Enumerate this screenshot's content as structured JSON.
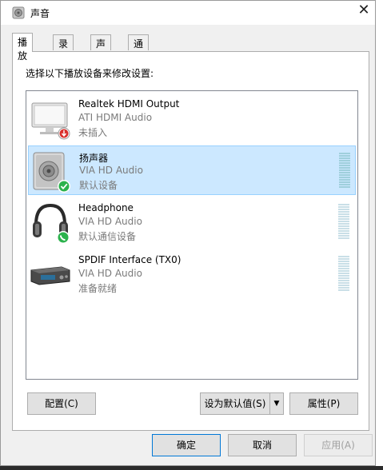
{
  "window": {
    "title": "声音",
    "close_glyph": "✕"
  },
  "tabs": [
    {
      "label": "播放",
      "active": true
    },
    {
      "label": "录制",
      "active": false
    },
    {
      "label": "声音",
      "active": false
    },
    {
      "label": "通信",
      "active": false
    }
  ],
  "panel": {
    "instruction": "选择以下播放设备来修改设置:"
  },
  "devices": [
    {
      "name": "Realtek HDMI Output",
      "driver": "ATI HDMI Audio",
      "status": "未插入",
      "icon": "hdmi-monitor-icon",
      "badge": "unplugged-badge-icon",
      "selected": false
    },
    {
      "name": "扬声器",
      "driver": "VIA HD Audio",
      "status": "默认设备",
      "icon": "speaker-icon",
      "badge": "default-check-badge-icon",
      "selected": true
    },
    {
      "name": "Headphone",
      "driver": "VIA HD Audio",
      "status": "默认通信设备",
      "icon": "headphone-icon",
      "badge": "phone-badge-icon",
      "selected": false
    },
    {
      "name": "SPDIF Interface (TX0)",
      "driver": "VIA HD Audio",
      "status": "准备就绪",
      "icon": "spdif-device-icon",
      "badge": "",
      "selected": false
    }
  ],
  "panel_buttons": {
    "configure": "配置(C)",
    "set_default": "设为默认值(S)",
    "set_default_arrow": "▼",
    "properties": "属性(P)"
  },
  "dialog_buttons": {
    "ok": "确定",
    "cancel": "取消",
    "apply": "应用(A)"
  },
  "colors": {
    "selection_bg": "#cce8ff",
    "selection_border": "#99d1ff",
    "default_button_border": "#0078d7",
    "check_green": "#2bb24c",
    "unplug_red": "#d9302c"
  }
}
